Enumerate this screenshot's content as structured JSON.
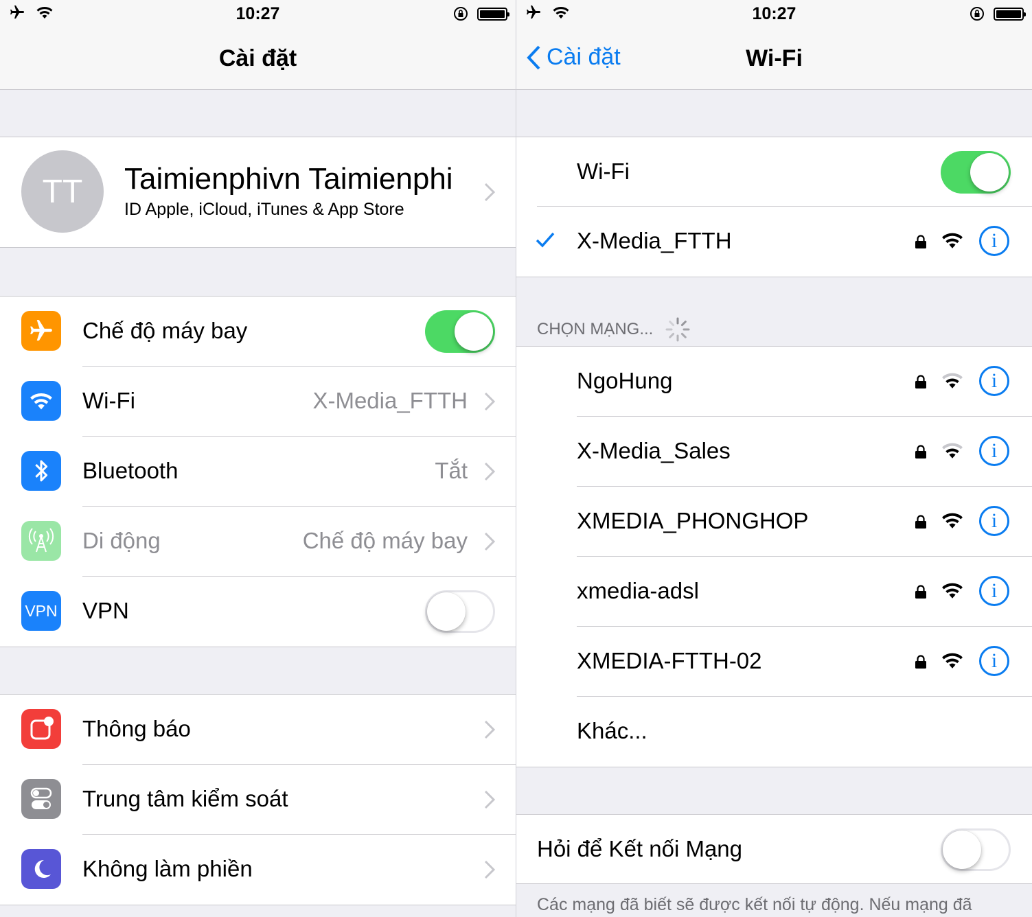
{
  "left": {
    "status": {
      "time": "10:27"
    },
    "nav": {
      "title": "Cài đặt"
    },
    "profile": {
      "initials": "TT",
      "name": "Taimienphivn Taimienphi",
      "subtitle": "ID Apple, iCloud, iTunes & App Store"
    },
    "group1": [
      {
        "label": "Chế độ máy bay",
        "toggle": "on",
        "icon": "airplane-icon",
        "color": "#ff9500"
      },
      {
        "label": "Wi-Fi",
        "value": "X-Media_FTTH",
        "icon": "wifi-icon",
        "color": "#1a82fb"
      },
      {
        "label": "Bluetooth",
        "value": "Tắt",
        "icon": "bluetooth-icon",
        "color": "#1a82fb"
      },
      {
        "label": "Di động",
        "value": "Chế độ máy bay",
        "icon": "cellular-antenna-icon",
        "color": "#9ae6a6",
        "disabled": true
      },
      {
        "label": "VPN",
        "toggle": "off",
        "icon": "vpn-icon",
        "icon_text": "VPN",
        "color": "#1a82fb"
      }
    ],
    "group2": [
      {
        "label": "Thông báo",
        "icon": "notifications-icon",
        "color": "#f23e3a"
      },
      {
        "label": "Trung tâm kiểm soát",
        "icon": "control-center-icon",
        "color": "#8e8e93"
      },
      {
        "label": "Không làm phiền",
        "icon": "moon-icon",
        "color": "#5856d6"
      }
    ]
  },
  "right": {
    "status": {
      "time": "10:27"
    },
    "nav": {
      "back": "Cài đặt",
      "title": "Wi-Fi"
    },
    "wifi_toggle": {
      "label": "Wi-Fi",
      "state": "on"
    },
    "connected": {
      "name": "X-Media_FTTH",
      "secured": true,
      "signal": "full"
    },
    "section_header": "CHỌN MẠNG...",
    "networks": [
      {
        "name": "NgoHung",
        "secured": true,
        "signal": "medium"
      },
      {
        "name": "X-Media_Sales",
        "secured": true,
        "signal": "medium"
      },
      {
        "name": "XMEDIA_PHONGHOP",
        "secured": true,
        "signal": "full"
      },
      {
        "name": "xmedia-adsl",
        "secured": true,
        "signal": "full"
      },
      {
        "name": "XMEDIA-FTTH-02",
        "secured": true,
        "signal": "full"
      }
    ],
    "other": "Khác...",
    "ask_to_join": {
      "label": "Hỏi để Kết nối Mạng",
      "state": "off"
    },
    "footer": "Các mạng đã biết sẽ được kết nối tự động. Nếu mạng đã"
  },
  "colors": {
    "accent": "#0a7cf0",
    "toggle_on": "#4cd964"
  }
}
